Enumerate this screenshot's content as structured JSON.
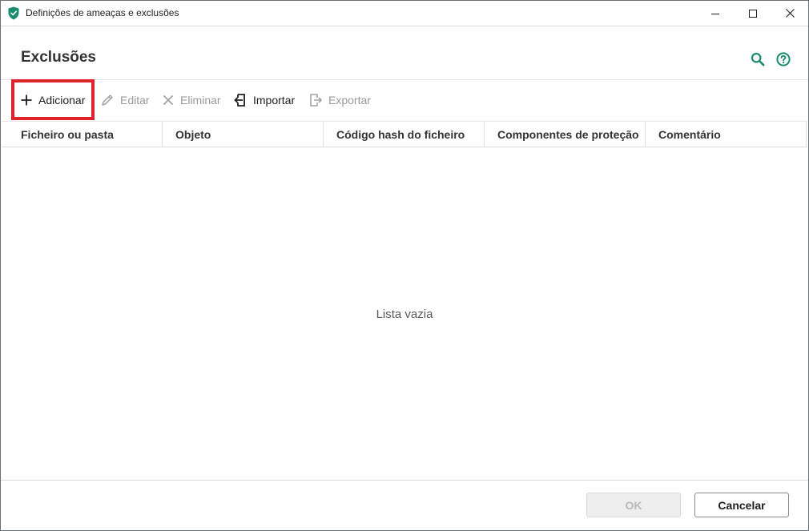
{
  "window": {
    "title": "Definições de ameaças e exclusões",
    "accent_color": "#1a8c6e"
  },
  "header": {
    "title": "Exclusões",
    "icons": [
      "search-icon",
      "help-icon"
    ]
  },
  "toolbar": {
    "add_label": "Adicionar",
    "edit_label": "Editar",
    "delete_label": "Eliminar",
    "import_label": "Importar",
    "export_label": "Exportar",
    "highlight_color": "#e0232b"
  },
  "table": {
    "columns": [
      "Ficheiro ou pasta",
      "Objeto",
      "Código hash do ficheiro",
      "Componentes de proteção",
      "Comentário"
    ],
    "rows": [],
    "empty_text": "Lista vazia"
  },
  "footer": {
    "ok_label": "OK",
    "cancel_label": "Cancelar"
  }
}
